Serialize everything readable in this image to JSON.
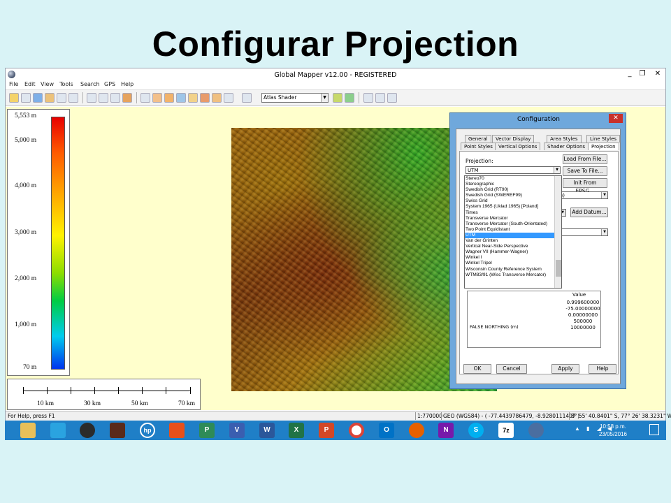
{
  "slide": {
    "title": "Configurar Projection"
  },
  "window": {
    "title": "Global Mapper v12.00 - REGISTERED",
    "min": "_",
    "max": "❐",
    "close": "✕"
  },
  "menu": [
    "File",
    "Edit",
    "View",
    "Tools",
    "Search",
    "GPS",
    "Help"
  ],
  "toolbar": {
    "shader_value": "Atlas Shader"
  },
  "legend": {
    "labels": [
      "5,553 m",
      "5,000 m",
      "4,000 m",
      "3,000 m",
      "2,000 m",
      "1,000 m",
      "70 m"
    ]
  },
  "scale": {
    "labels": [
      "10 km",
      "30 km",
      "50 km",
      "70 km"
    ]
  },
  "status": {
    "help": "For Help, press F1",
    "scale": "1:770000",
    "coords": "GEO (WGS84) - ( -77.4439786479, -8.9280111407 )",
    "dms": "8° 55' 40.8401\" S, 77° 26' 38.3231\" W"
  },
  "dialog": {
    "title": "Configuration",
    "close": "✕",
    "tabs_row1": [
      "General",
      "Vector Display",
      "Area Styles",
      "Line Styles"
    ],
    "tabs_row2": [
      "Point Styles",
      "Vertical Options",
      "Shader Options",
      "Projection"
    ],
    "projection_label": "Projection:",
    "projection_value": "UTM",
    "buttons": {
      "load": "Load From File...",
      "save": "Save To File...",
      "epsg": "Init From EPSG...",
      "add_datum": "Add Datum...",
      "ok": "OK",
      "cancel": "Cancel",
      "apply": "Apply",
      "help": "Help"
    },
    "combo_partial": "e)",
    "list_items": [
      "Stereo70",
      "Stereographic",
      "Swedish Grid (RT90)",
      "Swedish Grid (SWEREF99)",
      "Swiss Grid",
      "System 1965 (Uklad 1965) [Poland]",
      "Times",
      "Transverse Mercator",
      "Transverse Mercator (South-Orientated)",
      "Two Point Equidistant",
      "UTM",
      "Van der Grinten",
      "Vertical Near-Side Perspective",
      "Wagner VII (Hammer-Wagner)",
      "Winkel I",
      "Winkel Tripel",
      "Wisconsin County Reference System",
      "WTM83/91 (Wisc Transverse Mercator)"
    ],
    "selected_item": "UTM",
    "param_header": "Value",
    "param_values": [
      "0.999600000",
      "-75.00000000",
      "0.00000000",
      "500000",
      "10000000"
    ],
    "param_partial_row": "FALSE NORTHING (m)"
  },
  "taskbar": {
    "apps": [
      "file-explorer",
      "rocket",
      "media",
      "photos",
      "hp",
      "office",
      "publisher",
      "visio",
      "word",
      "excel",
      "powerpoint",
      "chrome",
      "outlook",
      "firefox",
      "onenote",
      "skype",
      "7zip",
      "global-mapper"
    ],
    "time": "10:58 p.m.",
    "date": "23/05/2016"
  },
  "colors": {
    "taskbar": "#1f7fc7",
    "selection": "#3399ff",
    "map_bg": "#ffffcc",
    "slide_bg": "#d9f3f6"
  }
}
